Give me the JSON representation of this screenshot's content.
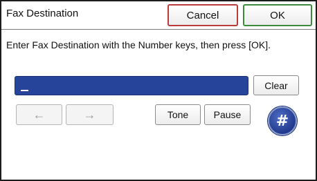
{
  "window": {
    "title": "Fax Destination",
    "cancel_label": "Cancel",
    "ok_label": "OK"
  },
  "instruction": "Enter Fax Destination with the Number keys, then press [OK].",
  "number_field": {
    "value": ""
  },
  "buttons": {
    "clear_label": "Clear",
    "left_arrow": "←",
    "right_arrow": "→",
    "tone_label": "Tone",
    "pause_label": "Pause",
    "hash_label": "#"
  },
  "colors": {
    "field_blue": "#26459a",
    "hash_blue": "#223a8e",
    "cancel_border": "#b83a3a",
    "ok_border": "#3c8a3c"
  },
  "icons": {
    "left": "arrow-left-icon",
    "right": "arrow-right-icon",
    "hash": "hash-icon"
  }
}
